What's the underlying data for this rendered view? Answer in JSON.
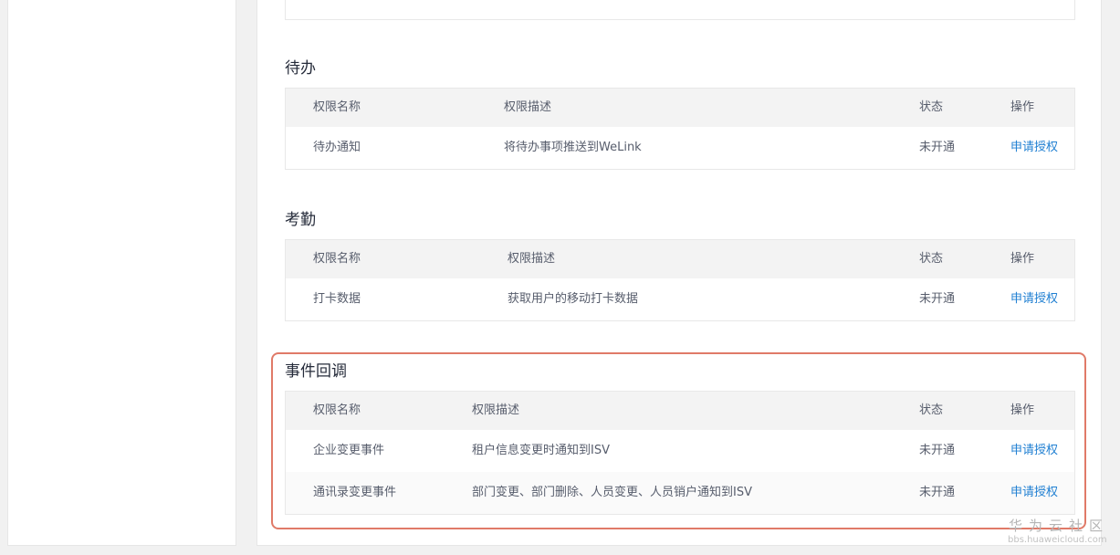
{
  "sections": [
    {
      "title": "待办",
      "headers": {
        "name": "权限名称",
        "desc": "权限描述",
        "status": "状态",
        "op": "操作"
      },
      "rows": [
        {
          "name": "待办通知",
          "desc": "将待办事项推送到WeLink",
          "status": "未开通",
          "action": "申请授权"
        }
      ]
    },
    {
      "title": "考勤",
      "headers": {
        "name": "权限名称",
        "desc": "权限描述",
        "status": "状态",
        "op": "操作"
      },
      "rows": [
        {
          "name": "打卡数据",
          "desc": "获取用户的移动打卡数据",
          "status": "未开通",
          "action": "申请授权"
        }
      ]
    },
    {
      "title": "事件回调",
      "headers": {
        "name": "权限名称",
        "desc": "权限描述",
        "status": "状态",
        "op": "操作"
      },
      "rows": [
        {
          "name": "企业变更事件",
          "desc": "租户信息变更时通知到ISV",
          "status": "未开通",
          "action": "申请授权"
        },
        {
          "name": "通讯录变更事件",
          "desc": "部门变更、部门删除、人员变更、人员销户通知到ISV",
          "status": "未开通",
          "action": "申请授权"
        }
      ]
    }
  ],
  "watermark": {
    "brand": "华为云社区",
    "url": "bbs.huaweicloud.com"
  },
  "colors": {
    "link": "#1f7fd2",
    "highlight": "#e07a68"
  }
}
